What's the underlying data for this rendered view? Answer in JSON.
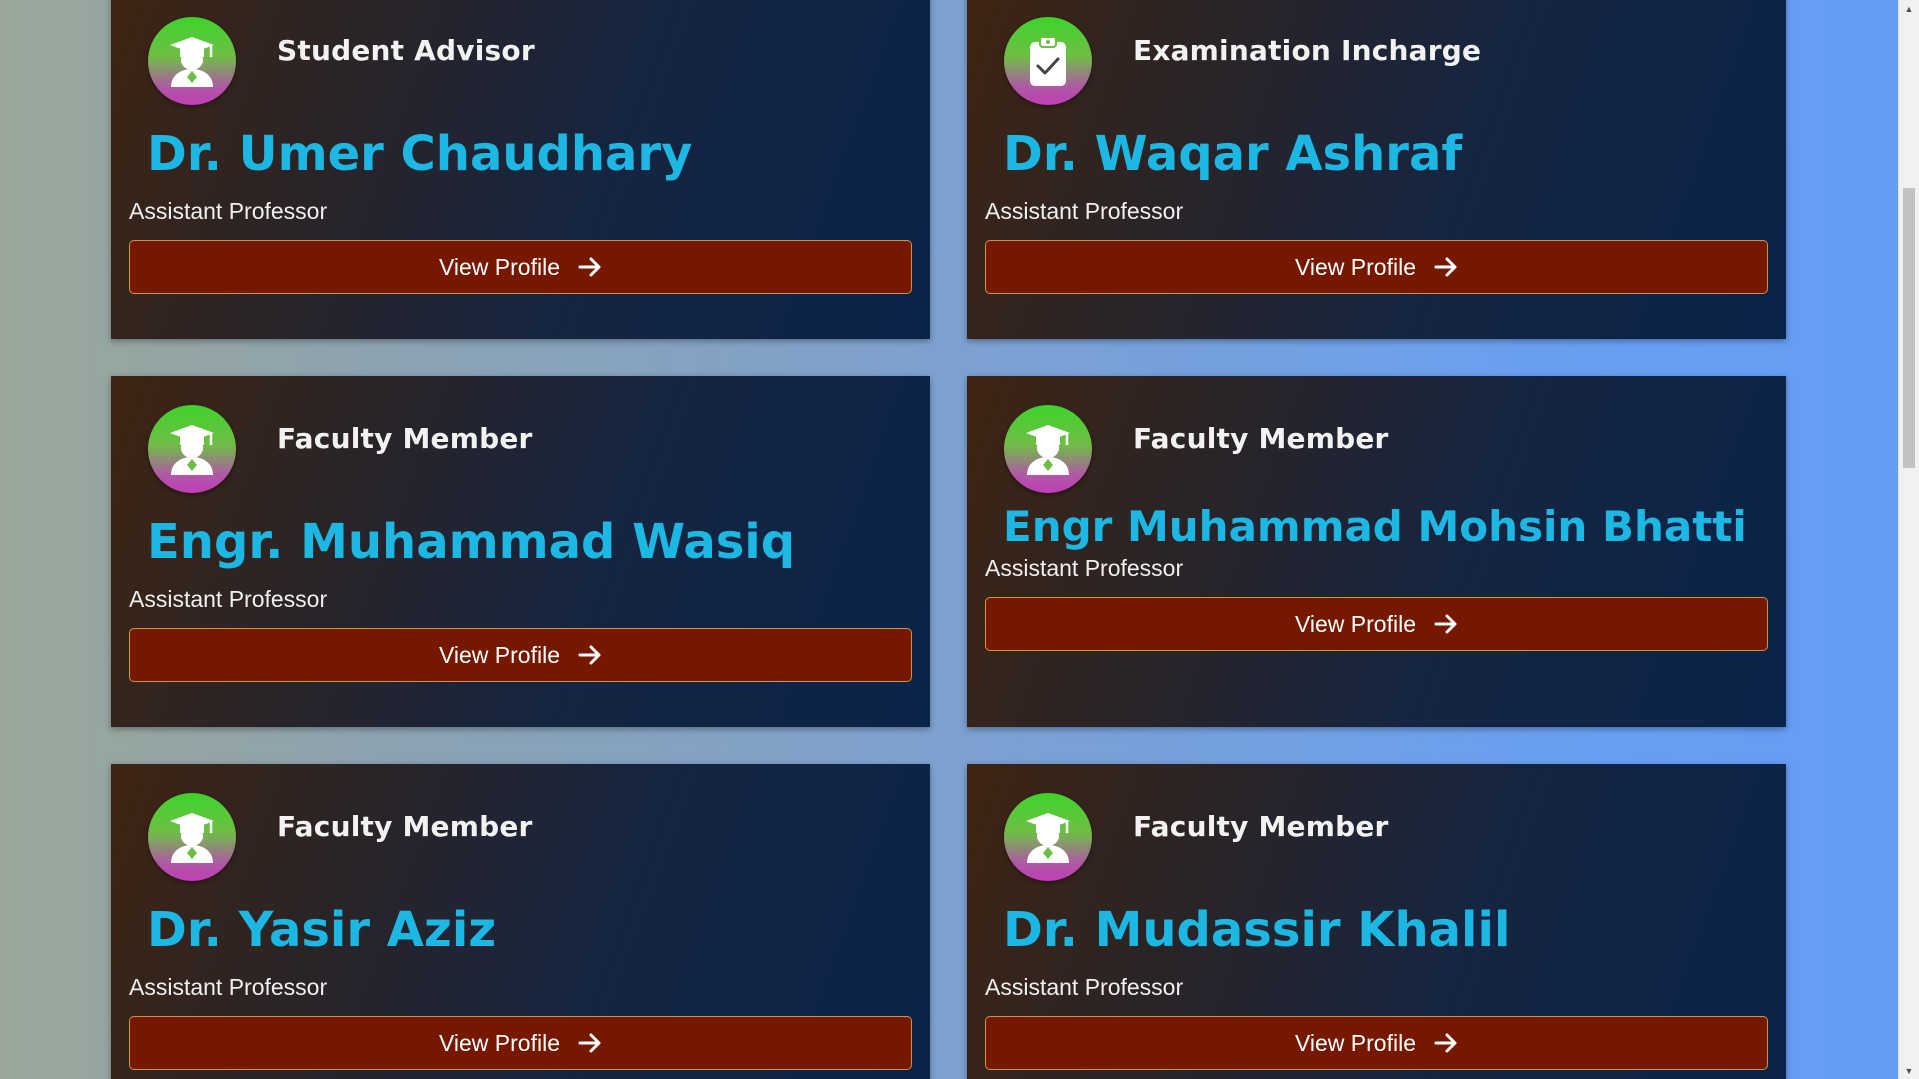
{
  "cards": [
    {
      "role": "Student Advisor",
      "name": "Dr. Umer Chaudhary",
      "designation": "Assistant Professor",
      "button": "View Profile",
      "icon": "graduate-icon"
    },
    {
      "role": "Examination Incharge",
      "name": "Dr. Waqar Ashraf",
      "designation": "Assistant Professor",
      "button": "View Profile",
      "icon": "clipboard-check-icon"
    },
    {
      "role": "Faculty Member",
      "name": "Engr. Muhammad Wasiq",
      "designation": "Assistant Professor",
      "button": "View Profile",
      "icon": "graduate-icon"
    },
    {
      "role": "Faculty Member",
      "name": "Engr Muhammad Mohsin Bhatti",
      "designation": "Assistant Professor",
      "button": "View Profile",
      "icon": "graduate-icon"
    },
    {
      "role": "Faculty Member",
      "name": "Dr. Yasir Aziz",
      "designation": "Assistant Professor",
      "button": "View Profile",
      "icon": "graduate-icon"
    },
    {
      "role": "Faculty Member",
      "name": "Dr. Mudassir Khalil",
      "designation": "Assistant Professor",
      "button": "View Profile",
      "icon": "graduate-icon"
    }
  ],
  "colors": {
    "name_text": "#1cb7e3",
    "button_bg": "#761800",
    "button_border": "#c99b2e",
    "card_bg_start": "#3f2412",
    "card_bg_end": "#0a2349",
    "avatar_top": "#3ed42a",
    "avatar_bottom": "#c03fb4"
  }
}
